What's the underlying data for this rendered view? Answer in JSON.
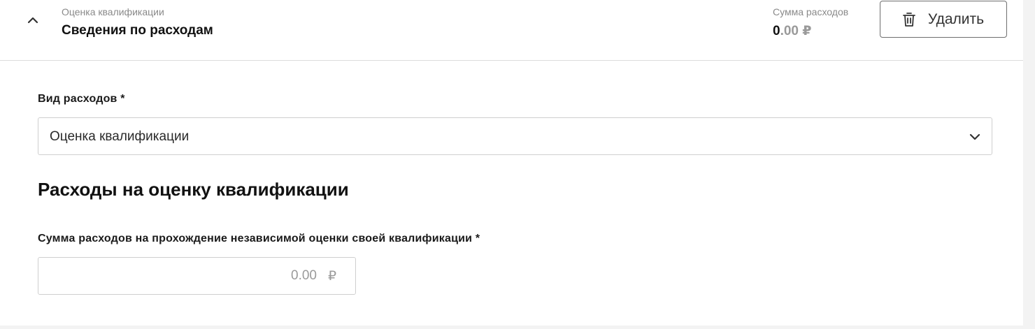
{
  "header": {
    "eyebrow": "Оценка квалификации",
    "title": "Сведения по расходам",
    "sum_label": "Сумма расходов",
    "sum_int": "0",
    "sum_frac": ".00 ₽",
    "delete_label": "Удалить",
    "icons": {
      "collapse": "chevron-up-icon",
      "delete": "trash-icon"
    }
  },
  "expense_type": {
    "label": "Вид расходов *",
    "value": "Оценка квалификации",
    "icon": "chevron-down-icon"
  },
  "section": {
    "title": "Расходы на оценку квалификации"
  },
  "amount": {
    "label": "Сумма расходов на прохождение независимой оценки своей квалификации *",
    "placeholder": "0.00",
    "currency": "₽"
  }
}
